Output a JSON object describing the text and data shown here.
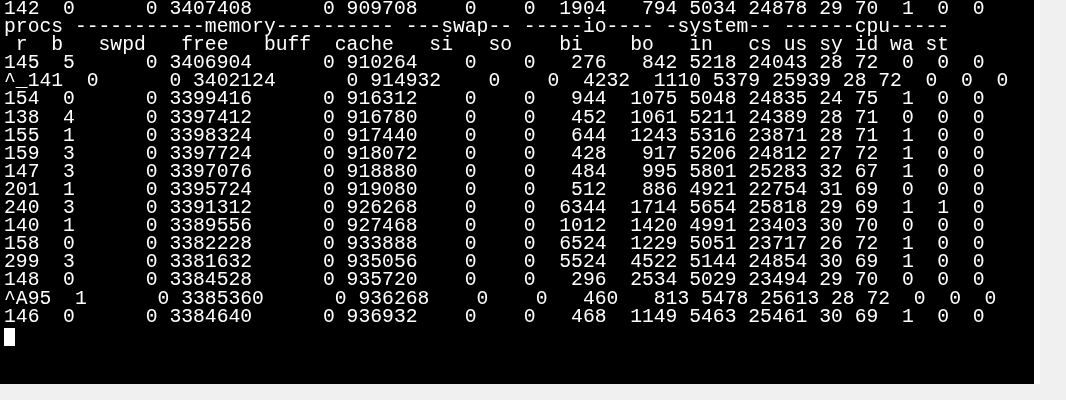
{
  "terminal": {
    "lines": [
      "142  0      0 3407408      0 909708    0    0  1904   794 5034 24878 29 70  1  0  0",
      "procs -----------memory---------- ---swap-- -----io---- -system-- ------cpu-----",
      " r  b   swpd   free   buff  cache   si   so    bi    bo   in   cs us sy id wa st",
      "145  5      0 3406904      0 910264    0    0   276   842 5218 24043 28 72  0  0  0",
      "^_141  0      0 3402124      0 914932    0    0  4232  1110 5379 25939 28 72  0  0  0",
      "154  0      0 3399416      0 916312    0    0   944  1075 5048 24835 24 75  1  0  0",
      "138  4      0 3397412      0 916780    0    0   452  1061 5211 24389 28 71  0  0  0",
      "155  1      0 3398324      0 917440    0    0   644  1243 5316 23871 28 71  1  0  0",
      "159  3      0 3397724      0 918072    0    0   428   917 5206 24812 27 72  1  0  0",
      "147  3      0 3397076      0 918880    0    0   484   995 5801 25283 32 67  1  0  0",
      "201  1      0 3395724      0 919080    0    0   512   886 4921 22754 31 69  0  0  0",
      "240  3      0 3391312      0 926268    0    0  6344  1714 5654 25818 29 69  1  1  0",
      "140  1      0 3389556      0 927468    0    0  1012  1420 4991 23403 30 70  0  0  0",
      "158  0      0 3382228      0 933888    0    0  6524  1229 5051 23717 26 72  1  0  0",
      "299  3      0 3381632      0 935056    0    0  5524  4522 5144 24854 30 69  1  0  0",
      "148  0      0 3384528      0 935720    0    0   296  2534 5029 23494 29 70  0  0  0",
      "^A95  1      0 3385360      0 936268    0    0   460   813 5478 25613 28 72  0  0  0",
      "146  0      0 3384640      0 936932    0    0   468  1149 5463 25461 30 69  1  0  0"
    ],
    "cursor_visible": true
  }
}
